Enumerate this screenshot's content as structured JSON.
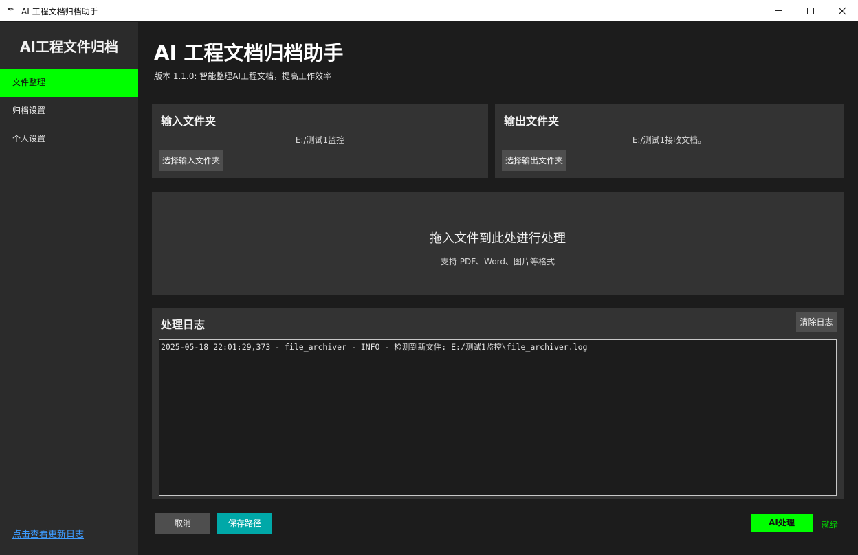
{
  "window": {
    "title": "AI 工程文档归档助手",
    "app_icon": "feather-icon"
  },
  "sidebar": {
    "brand": "AI工程文件归档",
    "items": [
      {
        "label": "文件整理",
        "active": true
      },
      {
        "label": "归档设置",
        "active": false
      },
      {
        "label": "个人设置",
        "active": false
      }
    ],
    "changelog_link": "点击查看更新日志"
  },
  "header": {
    "title": "AI 工程文档归档助手",
    "subtitle": "版本 1.1.0: 智能整理AI工程文档，提高工作效率"
  },
  "input_folder": {
    "title": "输入文件夹",
    "path": "E:/测试1监控",
    "button": "选择输入文件夹"
  },
  "output_folder": {
    "title": "输出文件夹",
    "path": "E:/测试1接收文档。",
    "button": "选择输出文件夹"
  },
  "drop_zone": {
    "title": "拖入文件到此处进行处理",
    "subtitle": "支持 PDF、Word、图片等格式"
  },
  "log": {
    "title": "处理日志",
    "clear_button": "清除日志",
    "lines": [
      "2025-05-18 22:01:29,373 - file_archiver - INFO - 检测到新文件: E:/测试1监控\\file_archiver.log"
    ]
  },
  "footer": {
    "cancel": "取消",
    "save_path": "保存路径",
    "ai_process": "AI处理",
    "status": "就绪"
  },
  "colors": {
    "accent_green": "#00ff00",
    "save_teal": "#00a8a8",
    "link_blue": "#3d9bff"
  }
}
